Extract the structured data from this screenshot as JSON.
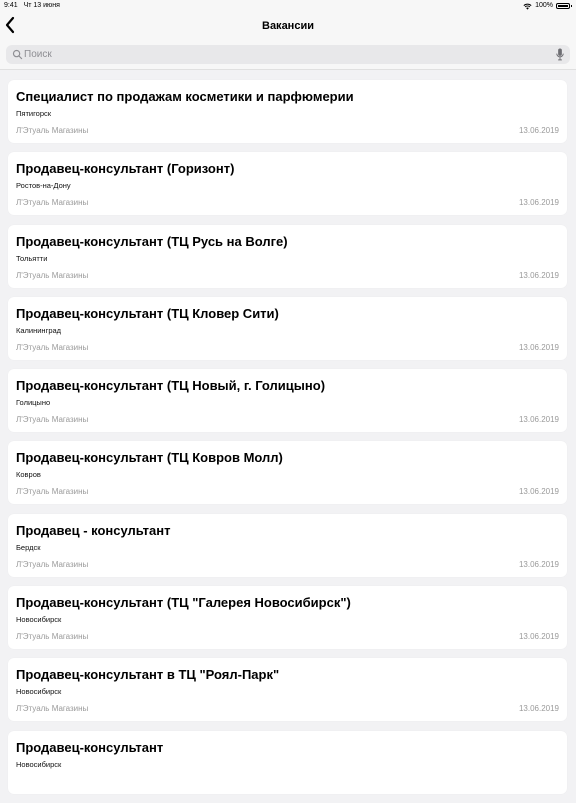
{
  "status_bar": {
    "time": "9:41",
    "date": "Чт 13 июня",
    "battery": "100%",
    "battery_level": 1.0
  },
  "nav": {
    "title": "Вакансии"
  },
  "search": {
    "placeholder": "Поиск"
  },
  "vacancies": [
    {
      "title": "Специалист по продажам косметики и парфюмерии",
      "city": "Пятигорск",
      "company": "Л'Этуаль Магазины",
      "date": "13.06.2019"
    },
    {
      "title": "Продавец-консультант (Горизонт)",
      "city": "Ростов-на-Дону",
      "company": "Л'Этуаль Магазины",
      "date": "13.06.2019"
    },
    {
      "title": "Продавец-консультант (ТЦ Русь на Волге)",
      "city": "Тольятти",
      "company": "Л'Этуаль Магазины",
      "date": "13.06.2019"
    },
    {
      "title": "Продавец-консультант (ТЦ Кловер Сити)",
      "city": "Калининград",
      "company": "Л'Этуаль Магазины",
      "date": "13.06.2019"
    },
    {
      "title": "Продавец-консультант (ТЦ Новый, г. Голицыно)",
      "city": "Голицыно",
      "company": "Л'Этуаль Магазины",
      "date": "13.06.2019"
    },
    {
      "title": "Продавец-консультант (ТЦ Ковров Молл)",
      "city": "Ковров",
      "company": "Л'Этуаль Магазины",
      "date": "13.06.2019"
    },
    {
      "title": "Продавец - консультант",
      "city": "Бердск",
      "company": "Л'Этуаль Магазины",
      "date": "13.06.2019"
    },
    {
      "title": "Продавец-консультант (ТЦ \"Галерея Новосибирск\")",
      "city": "Новосибирск",
      "company": "Л'Этуаль Магазины",
      "date": "13.06.2019"
    },
    {
      "title": "Продавец-консультант в ТЦ \"Роял-Парк\"",
      "city": "Новосибирск",
      "company": "Л'Этуаль Магазины",
      "date": "13.06.2019"
    },
    {
      "title": "Продавец-консультант",
      "city": "Новосибирск",
      "company": "",
      "date": ""
    }
  ]
}
